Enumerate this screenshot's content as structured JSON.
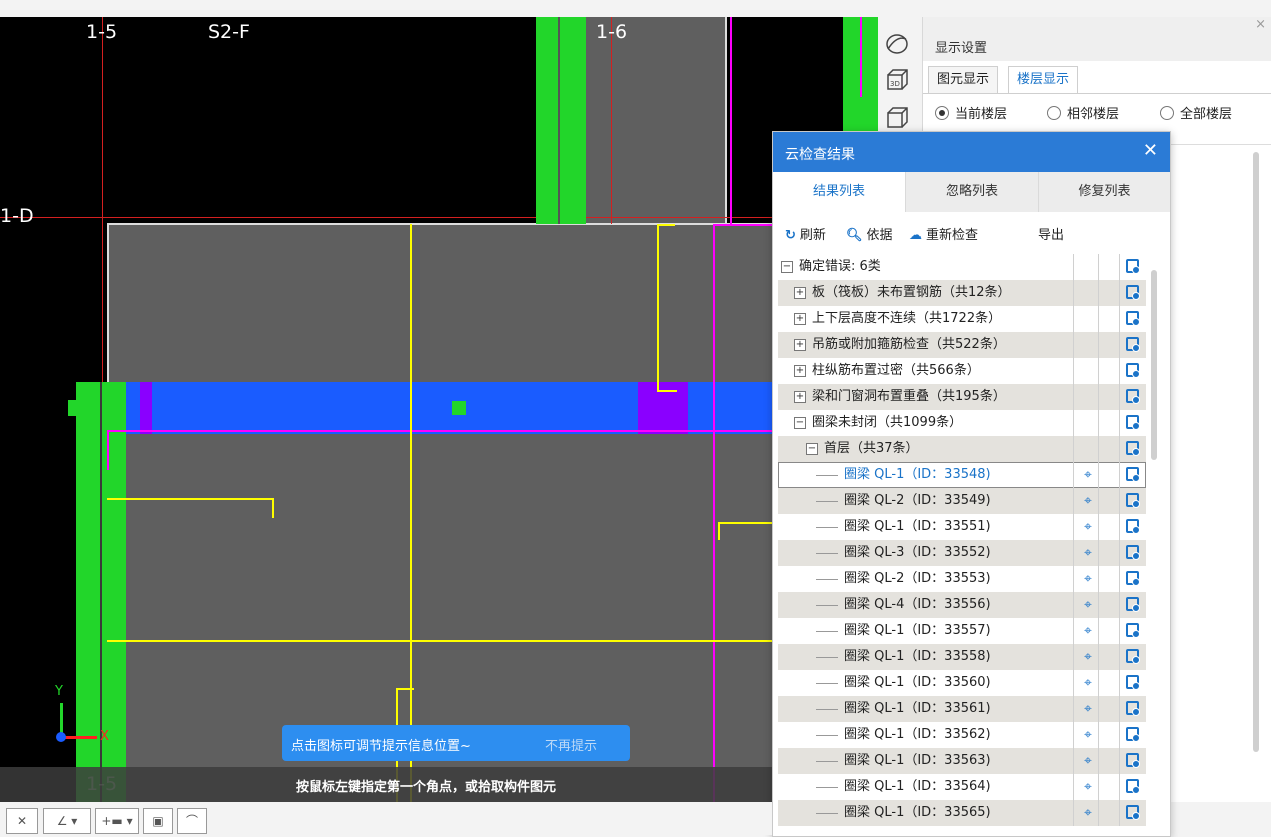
{
  "cad": {
    "grid_labels": [
      "1-5",
      "S2-F",
      "1-6",
      "1-D",
      "1-5"
    ],
    "axis_y": "Y",
    "axis_x": "X"
  },
  "tooltip": {
    "message": "点击图标可调节提示信息位置~",
    "dismiss": "不再提示"
  },
  "status": {
    "text": "按鼠标左键指定第一个角点，或拾取构件图元"
  },
  "display_settings": {
    "title": "显示设置",
    "tabs": [
      "图元显示",
      "楼层显示"
    ],
    "active_tab": "楼层显示",
    "radios": [
      "当前楼层",
      "相邻楼层",
      "全部楼层"
    ],
    "selected_radio": "当前楼层",
    "close": "×"
  },
  "cloud_check": {
    "title": "云检查结果",
    "close": "✕",
    "tabs": [
      "结果列表",
      "忽略列表",
      "修复列表"
    ],
    "active_tab": "结果列表",
    "toolbar": {
      "refresh": "刷新",
      "basis": "依据",
      "recheck": "重新检查",
      "export": "导出"
    },
    "rows": [
      {
        "label": "确定错误: 6类",
        "level": 0,
        "expander": "−"
      },
      {
        "label": "板（筏板）未布置钢筋（共12条）",
        "level": 1,
        "expander": "+"
      },
      {
        "label": "上下层高度不连续（共1722条）",
        "level": 1,
        "expander": "+"
      },
      {
        "label": "吊筋或附加箍筋检查（共522条）",
        "level": 1,
        "expander": "+"
      },
      {
        "label": "柱纵筋布置过密（共566条）",
        "level": 1,
        "expander": "+"
      },
      {
        "label": "梁和门窗洞布置重叠（共195条）",
        "level": 1,
        "expander": "+"
      },
      {
        "label": "圈梁未封闭（共1099条）",
        "level": 1,
        "expander": "−"
      },
      {
        "label": "首层（共37条）",
        "level": 2,
        "expander": "−"
      },
      {
        "label": "圈梁 QL-1（ID：33548)",
        "level": 3,
        "selected": true
      },
      {
        "label": "圈梁 QL-2（ID：33549)",
        "level": 3
      },
      {
        "label": "圈梁 QL-1（ID：33551)",
        "level": 3
      },
      {
        "label": "圈梁 QL-3（ID：33552)",
        "level": 3
      },
      {
        "label": "圈梁 QL-2（ID：33553)",
        "level": 3
      },
      {
        "label": "圈梁 QL-4（ID：33556)",
        "level": 3
      },
      {
        "label": "圈梁 QL-1（ID：33557)",
        "level": 3
      },
      {
        "label": "圈梁 QL-1（ID：33558)",
        "level": 3
      },
      {
        "label": "圈梁 QL-1（ID：33560)",
        "level": 3
      },
      {
        "label": "圈梁 QL-1（ID：33561)",
        "level": 3
      },
      {
        "label": "圈梁 QL-1（ID：33562)",
        "level": 3
      },
      {
        "label": "圈梁 QL-1（ID：33563)",
        "level": 3
      },
      {
        "label": "圈梁 QL-1（ID：33564)",
        "level": 3
      },
      {
        "label": "圈梁 QL-1（ID：33565)",
        "level": 3
      }
    ]
  },
  "colors": {
    "accent": "#2b7bd6",
    "cad_background": "#000000",
    "slab_gray": "#5f5f5f",
    "beam_blue": "#1a5cff",
    "wall_green": "#22d62a",
    "rebar_yellow": "#ffff00",
    "column_magenta": "#ff00ff",
    "column_purple": "#8a00ff"
  }
}
